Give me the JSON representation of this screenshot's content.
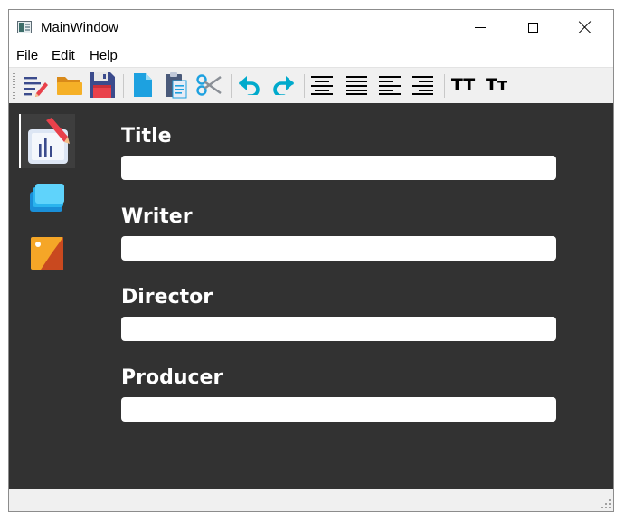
{
  "window": {
    "title": "MainWindow"
  },
  "menu": {
    "file": "File",
    "edit": "Edit",
    "help": "Help"
  },
  "toolbar": {
    "icons": [
      "edit-document-icon",
      "open-folder-icon",
      "save-icon",
      "new-file-icon",
      "paste-icon",
      "cut-icon",
      "undo-icon",
      "redo-icon",
      "align-center-icon",
      "align-justify-icon",
      "align-left-icon",
      "align-right-icon",
      "uppercase-icon",
      "small-caps-icon"
    ],
    "uppercase_label": "TT",
    "small_caps_label": "Tт"
  },
  "sidebar": {
    "items": [
      {
        "icon": "edit-board-icon",
        "active": true
      },
      {
        "icon": "cards-stack-icon",
        "active": false
      },
      {
        "icon": "image-tag-icon",
        "active": false
      }
    ]
  },
  "form": {
    "fields": [
      {
        "label": "Title",
        "value": ""
      },
      {
        "label": "Writer",
        "value": ""
      },
      {
        "label": "Director",
        "value": ""
      },
      {
        "label": "Producer",
        "value": ""
      }
    ]
  },
  "colors": {
    "background": "#323232",
    "accent_blue": "#1da1e0",
    "folder_yellow": "#f5b027",
    "save_navy": "#3b4b8c"
  }
}
